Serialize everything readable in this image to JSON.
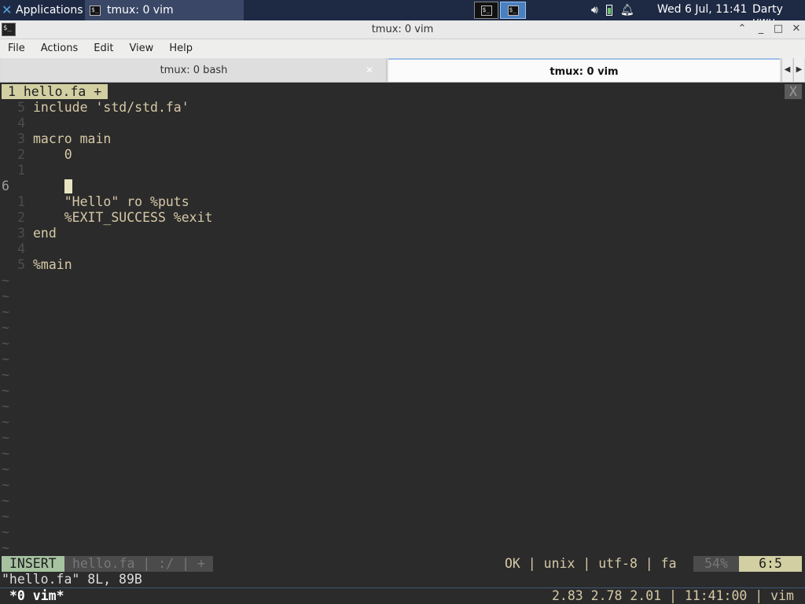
{
  "panel": {
    "applications_label": "Applications",
    "task_title": "tmux: 0 vim",
    "clock": "Wed  6 Jul, 11:41",
    "user": "Darty uwu"
  },
  "window": {
    "title": "tmux: 0 vim",
    "menu": [
      "File",
      "Actions",
      "Edit",
      "View",
      "Help"
    ],
    "tabs": [
      {
        "label": "tmux: 0 bash",
        "active": false
      },
      {
        "label": "tmux: 0 vim",
        "active": true
      }
    ]
  },
  "vim": {
    "tabline_label": "1 hello.fa +",
    "tabline_close": "X",
    "lines": [
      {
        "num": "5",
        "text": "include 'std/std.fa'"
      },
      {
        "num": "4",
        "text": ""
      },
      {
        "num": "3",
        "text": "macro main"
      },
      {
        "num": "2",
        "text": "    0"
      },
      {
        "num": "1",
        "text": ""
      },
      {
        "num": "6",
        "text": "    ",
        "current": true
      },
      {
        "num": "1",
        "text": "    \"Hello\" ro %puts"
      },
      {
        "num": "2",
        "text": "    %EXIT_SUCCESS %exit"
      },
      {
        "num": "3",
        "text": "end"
      },
      {
        "num": "4",
        "text": ""
      },
      {
        "num": "5",
        "text": "%main"
      }
    ],
    "tilde": "~",
    "status": {
      "mode": "INSERT",
      "fileinfo": "hello.fa | :/ | +",
      "right": "OK | unix | utf-8 | fa",
      "percent": "54%",
      "position": "6:5"
    },
    "message": "\"hello.fa\" 8L, 89B"
  },
  "tmux": {
    "window": "*0 vim*",
    "right": "2.83 2.78 2.01 | 11:41:00 | vim"
  },
  "colors": {
    "panel_bg": "#1e2a44",
    "term_bg": "#2b2b2b",
    "text": "#d6c9a7",
    "mode_bg": "#a6c2a0",
    "pos_bg": "#d2cfa2"
  }
}
